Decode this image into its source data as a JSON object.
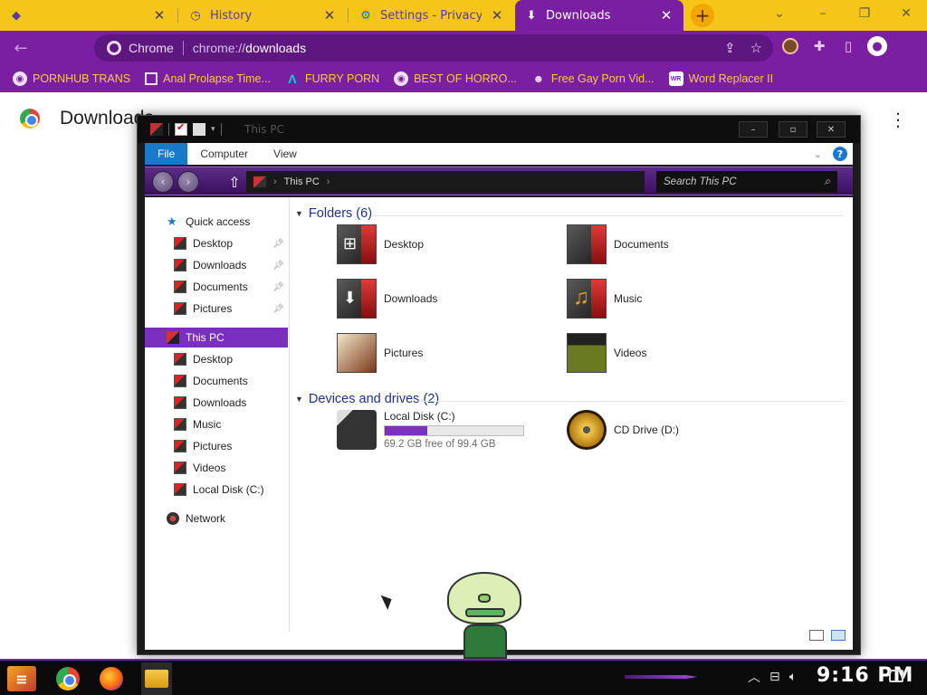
{
  "browser": {
    "tabs": [
      {
        "title": "",
        "icon": "peridot-favicon",
        "active": false
      },
      {
        "title": "History",
        "icon": "history-icon",
        "active": false
      },
      {
        "title": "Settings - Privacy and",
        "icon": "settings-icon",
        "active": false
      },
      {
        "title": "Downloads",
        "icon": "download-icon",
        "active": true
      }
    ],
    "new_tab_symbol": "+",
    "window_controls": {
      "search": "⌄",
      "minimize": "–",
      "restore": "❐",
      "close": "✕"
    },
    "address": {
      "chip_label": "Chrome",
      "scheme": "chrome://",
      "host": "downloads"
    },
    "bookmarks": [
      {
        "label": "PORNHUB TRANS",
        "icon": "globe-icon"
      },
      {
        "label": "Anal Prolapse Time...",
        "icon": "page-icon"
      },
      {
        "label": "FURRY PORN",
        "icon": "triangle-logo-icon"
      },
      {
        "label": "BEST OF HORRO...",
        "icon": "globe-icon"
      },
      {
        "label": "Free Gay Porn Vid...",
        "icon": "mascot-icon"
      },
      {
        "label": "Word Replacer II",
        "icon": "wr-icon"
      }
    ],
    "accent_color": "#7b1fa2",
    "tab_strip_color": "#f5c518"
  },
  "page": {
    "title": "Downloads"
  },
  "explorer": {
    "window_title": "This PC",
    "title_buttons": {
      "minimize": "–",
      "maximize": "▫",
      "close": "✕"
    },
    "ribbon_tabs": [
      "File",
      "Computer",
      "View"
    ],
    "help_label": "?",
    "address_path": "This PC",
    "search_placeholder": "Search This PC",
    "nav_pane": [
      {
        "label": "Quick access",
        "kind": "star",
        "indent": 0,
        "pinned": false,
        "selected": false
      },
      {
        "label": "Desktop",
        "kind": "red",
        "indent": 1,
        "pinned": true,
        "selected": false
      },
      {
        "label": "Downloads",
        "kind": "red",
        "indent": 1,
        "pinned": true,
        "selected": false
      },
      {
        "label": "Documents",
        "kind": "red",
        "indent": 1,
        "pinned": true,
        "selected": false
      },
      {
        "label": "Pictures",
        "kind": "red",
        "indent": 1,
        "pinned": true,
        "selected": false
      },
      {
        "label": "This PC",
        "kind": "pcic",
        "indent": 0,
        "pinned": false,
        "selected": true
      },
      {
        "label": "Desktop",
        "kind": "red",
        "indent": 1,
        "pinned": false,
        "selected": false
      },
      {
        "label": "Documents",
        "kind": "red",
        "indent": 1,
        "pinned": false,
        "selected": false
      },
      {
        "label": "Downloads",
        "kind": "red",
        "indent": 1,
        "pinned": false,
        "selected": false
      },
      {
        "label": "Music",
        "kind": "red",
        "indent": 1,
        "pinned": false,
        "selected": false
      },
      {
        "label": "Pictures",
        "kind": "red",
        "indent": 1,
        "pinned": false,
        "selected": false
      },
      {
        "label": "Videos",
        "kind": "red",
        "indent": 1,
        "pinned": false,
        "selected": false
      },
      {
        "label": "Local Disk (C:)",
        "kind": "red",
        "indent": 1,
        "pinned": false,
        "selected": false
      },
      {
        "label": "Network",
        "kind": "net",
        "indent": 0,
        "pinned": false,
        "selected": false
      }
    ],
    "folders_header": "Folders (6)",
    "folders": [
      {
        "label": "Desktop",
        "icon": "desktop-folder-icon",
        "glyph": "⊞"
      },
      {
        "label": "Documents",
        "icon": "documents-folder-icon",
        "glyph": ""
      },
      {
        "label": "Downloads",
        "icon": "downloads-folder-icon",
        "glyph": "⬇"
      },
      {
        "label": "Music",
        "icon": "music-folder-icon",
        "glyph": "♫"
      },
      {
        "label": "Pictures",
        "icon": "pictures-folder-icon",
        "glyph": ""
      },
      {
        "label": "Videos",
        "icon": "videos-folder-icon",
        "glyph": ""
      }
    ],
    "drives_header": "Devices and drives (2)",
    "drives": [
      {
        "label": "Local Disk (C:)",
        "free_text": "69.2 GB free of 99.4 GB",
        "used_fraction": 0.304,
        "icon": "hard-disk-icon"
      },
      {
        "label": "CD Drive (D:)",
        "icon": "cd-drive-icon"
      }
    ]
  },
  "taskbar": {
    "clock": "9:16 PM",
    "apps": [
      "chrome",
      "firefox",
      "file-explorer"
    ]
  }
}
